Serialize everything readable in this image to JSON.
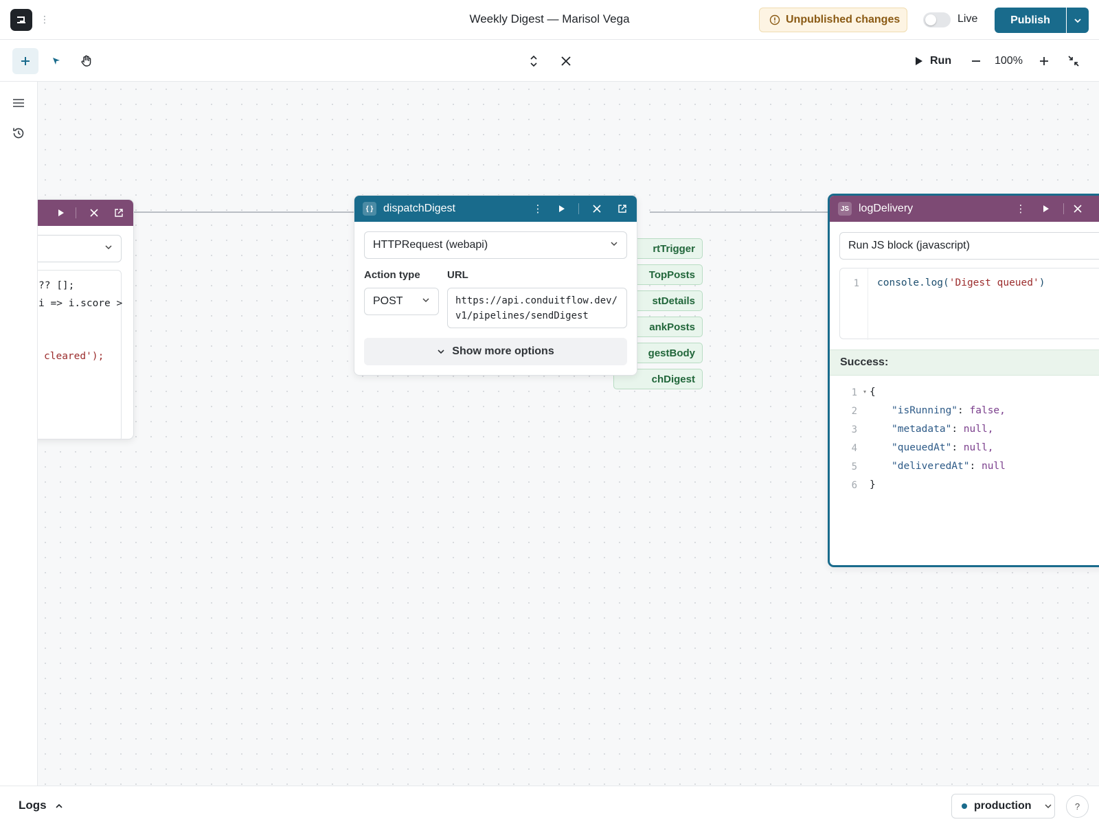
{
  "app": {
    "title": "Weekly Digest — Marisol Vega",
    "unpublished_label": "Unpublished changes",
    "live_label": "Live",
    "live_enabled": false,
    "publish_label": "Publish"
  },
  "toolbar": {
    "tools": [
      "plus-icon",
      "pointer-icon",
      "hand-icon"
    ],
    "run_label": "Run",
    "zoom": "100%"
  },
  "leftrail": {
    "items": [
      "menu-icon",
      "history-icon"
    ]
  },
  "left_node": {
    "code_lines": [
      "?? [];",
      "i => i.score >",
      "",
      "",
      "cleared');"
    ]
  },
  "dispatch_node": {
    "name": "dispatchDigest",
    "resource": "HTTPRequest (webapi)",
    "action_type_label": "Action type",
    "action_type": "POST",
    "url_label": "URL",
    "url_line1": "https://api.conduitflow.dev/",
    "url_line2": "v1/pipelines/sendDigest",
    "more_options": "Show more options"
  },
  "step_pills": [
    "rtTrigger",
    "TopPosts",
    "stDetails",
    "ankPosts",
    "gestBody",
    "chDigest"
  ],
  "log_node": {
    "badge": "JS",
    "name": "logDelivery",
    "resource": "Run JS block (javascript)",
    "code": {
      "line_no": "1",
      "fn": "console.log(",
      "str": "'Digest queued'",
      "close": ")"
    },
    "success_label": "Success:",
    "output": {
      "line_numbers": [
        "1",
        "2",
        "3",
        "4",
        "5",
        "6"
      ],
      "open": "{",
      "close": "}",
      "entries": [
        {
          "key": "\"isRunning\"",
          "value": "false,"
        },
        {
          "key": "\"metadata\"",
          "value": "null,"
        },
        {
          "key": "\"queuedAt\"",
          "value": "null,"
        },
        {
          "key": "\"deliveredAt\"",
          "value": "null"
        }
      ]
    }
  },
  "bottom": {
    "logs_label": "Logs",
    "environment": "production",
    "help": "?"
  },
  "colors": {
    "accent": "#196b8c",
    "js_header": "#7d4a74",
    "warning_bg": "#fdf4e3",
    "success_bg": "#eaf4ec"
  }
}
